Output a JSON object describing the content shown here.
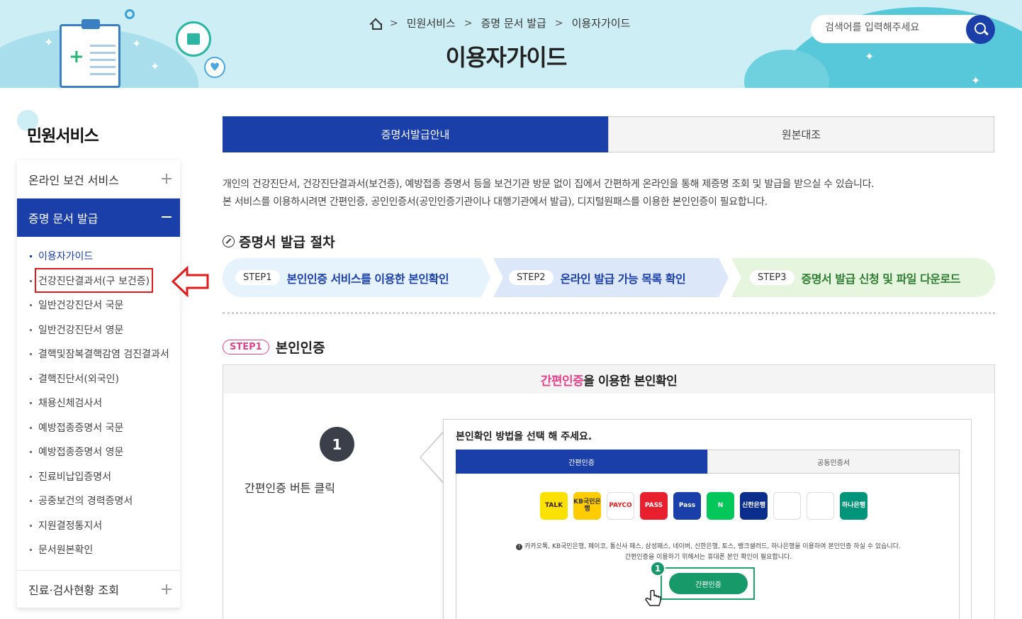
{
  "header": {
    "breadcrumb": [
      "민원서비스",
      "증명 문서 발급",
      "이용자가이드"
    ],
    "page_title": "이용자가이드",
    "search_placeholder": "검색어를 입력해주세요"
  },
  "sidebar": {
    "title": "민원서비스",
    "menus": [
      {
        "label": "온라인 보건 서비스",
        "state": "collapsed"
      },
      {
        "label": "증명 문서 발급",
        "state": "expanded"
      },
      {
        "label": "진료·검사현황 조회",
        "state": "collapsed"
      }
    ],
    "sub_items": [
      "이용자가이드",
      "건강진단결과서(구 보건증)",
      "일반건강진단서 국문",
      "일반건강진단서 영문",
      "결핵및잠복결핵감염 검진결과서",
      "결핵진단서(외국인)",
      "채용신체검사서",
      "예방접종증명서 국문",
      "예방접종증명서 영문",
      "진료비납입증명서",
      "공중보건의 경력증명서",
      "지원결정통지서",
      "문서원본확인"
    ]
  },
  "tabs": [
    "증명서발급안내",
    "원본대조"
  ],
  "description": [
    "개인의 건강진단서, 건강진단결과서(보건증), 예방접종 증명서 등을 보건기관 방문 없이 집에서 간편하게 온라인을 통해 제증명 조회 및 발급을 받으실 수 있습니다.",
    "본 서비스를 이용하시려면 간편인증, 공인인증서(공인인증기관이나 대행기관에서 발급), 디지털원패스를 이용한 본인인증이 필요합니다."
  ],
  "procedure": {
    "title": "증명서 발급 절차",
    "steps": [
      {
        "badge": "STEP1",
        "text": "본인인증 서비스를 이용한 본인확인"
      },
      {
        "badge": "STEP2",
        "text": "온라인 발급 가능 목록 확인"
      },
      {
        "badge": "STEP3",
        "text": "증명서 발급 신청 및 파일 다운로드"
      }
    ]
  },
  "step1": {
    "badge": "STEP1",
    "title": "본인인증",
    "box_title_highlight": "간편인증",
    "box_title_rest": "을 이용한 본인확인",
    "number": "1",
    "caption": "간편인증 버튼 클릭",
    "panel": {
      "title": "본인확인 방법을 선택 해 주세요.",
      "tabs": [
        "간편인증",
        "공동인증서"
      ],
      "icons": [
        {
          "name": "kakao-talk-icon",
          "label": "TALK",
          "bg": "#fae100",
          "fg": "#3c1e1e"
        },
        {
          "name": "kb-bank-icon",
          "label": "KB국민은행",
          "bg": "#ffcc00",
          "fg": "#333333"
        },
        {
          "name": "payco-icon",
          "label": "PAYCO",
          "bg": "#ffffff",
          "fg": "#e02020"
        },
        {
          "name": "pass-icon",
          "label": "PASS",
          "bg": "#e8202e",
          "fg": "#ffffff"
        },
        {
          "name": "samsung-pass-icon",
          "label": "Pass",
          "bg": "#1b3fa8",
          "fg": "#ffffff"
        },
        {
          "name": "naver-icon",
          "label": "N",
          "bg": "#03c75a",
          "fg": "#ffffff"
        },
        {
          "name": "shinhan-bank-icon",
          "label": "신한은행",
          "bg": "#0b2d8c",
          "fg": "#ffffff"
        },
        {
          "name": "toss-icon",
          "label": "",
          "bg": "#ffffff",
          "fg": "#2f7df6"
        },
        {
          "name": "banksalad-icon",
          "label": "",
          "bg": "#ffffff",
          "fg": "#00c07f"
        },
        {
          "name": "hana-bank-icon",
          "label": "하나은행",
          "bg": "#00957a",
          "fg": "#ffffff"
        }
      ],
      "note_line1": "카카오톡, KB국민은행, 페이코, 통신사 패스, 삼성패스, 네이버, 신한은행, 토스, 뱅크샐러드, 하나은행을 이용하여 본인인증 하실 수 있습니다.",
      "note_line2": "간편인증을 이용하기 위해서는 휴대폰 본인 확인이 필요합니다.",
      "button_label": "간편인증",
      "button_num": "1"
    }
  },
  "colors": {
    "primary": "#1b3fa8",
    "highlight": "#e0448a",
    "banner": "#cdeef4",
    "annotation_red": "#e01b1b"
  }
}
